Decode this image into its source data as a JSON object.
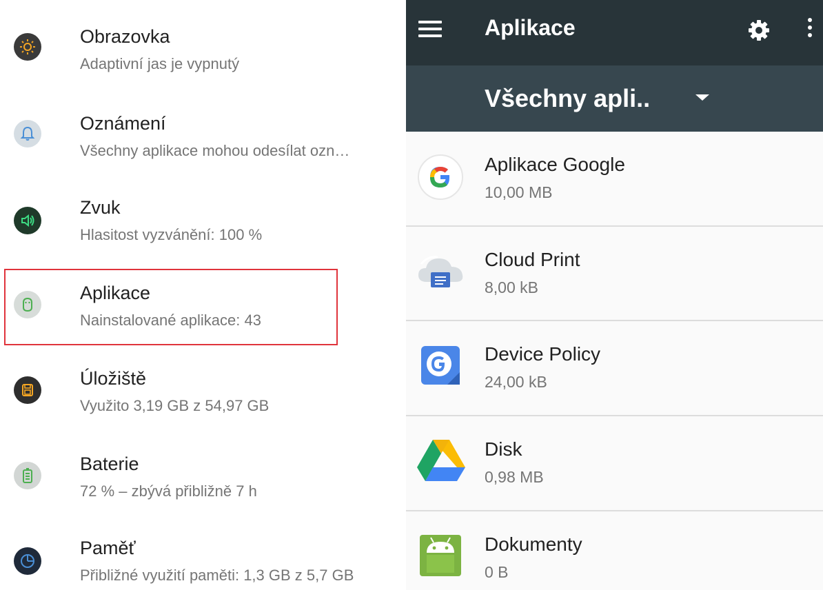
{
  "settings": {
    "items": [
      {
        "title": "Obrazovka",
        "subtitle": "Adaptivní jas je vypnutý",
        "icon": "display-brightness-icon"
      },
      {
        "title": "Oznámení",
        "subtitle": "Všechny aplikace mohou odesílat ozn…",
        "icon": "bell-icon"
      },
      {
        "title": "Zvuk",
        "subtitle": "Hlasitost vyzvánění: 100 %",
        "icon": "speaker-icon"
      },
      {
        "title": "Aplikace",
        "subtitle": "Nainstalované aplikace: 43",
        "icon": "android-head-icon"
      },
      {
        "title": "Úložiště",
        "subtitle": "Využito 3,19 GB z 54,97 GB",
        "icon": "storage-floppy-icon"
      },
      {
        "title": "Baterie",
        "subtitle": "72 % – zbývá přibližně 7 h",
        "icon": "battery-icon"
      },
      {
        "title": "Paměť",
        "subtitle": "Přibližné využití paměti: 1,3 GB z 5,7 GB",
        "icon": "memory-gauge-icon"
      }
    ],
    "highlight_color": "#e0333b"
  },
  "apps_screen": {
    "title": "Aplikace",
    "filter": "Všechny apli..",
    "appbar_color": "#283439",
    "filterbar_color": "#37474f",
    "apps": [
      {
        "name": "Aplikace Google",
        "size": "10,00 MB",
        "icon": "google-g-icon"
      },
      {
        "name": "Cloud Print",
        "size": "8,00 kB",
        "icon": "cloud-print-icon"
      },
      {
        "name": "Device Policy",
        "size": "24,00 kB",
        "icon": "device-policy-icon"
      },
      {
        "name": "Disk",
        "size": "0,98 MB",
        "icon": "google-drive-icon"
      },
      {
        "name": "Dokumenty",
        "size": "0 B",
        "icon": "android-icon"
      }
    ]
  }
}
